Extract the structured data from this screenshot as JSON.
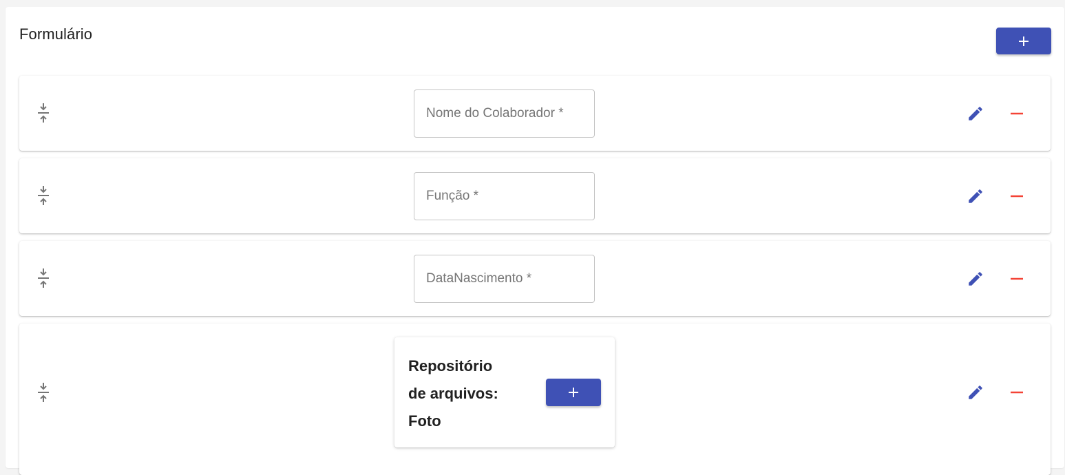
{
  "form": {
    "title": "Formulário",
    "add_icon": "plus-icon"
  },
  "fields": [
    {
      "label": "Nome do Colaborador *"
    },
    {
      "label": "Função *"
    },
    {
      "label": "DataNascimento *"
    }
  ],
  "repository": {
    "line1": "Repositório",
    "line2": "de arquivos:",
    "line3": "Foto"
  },
  "icons": {
    "drag": "drag-compress-icon",
    "edit": "pencil-icon",
    "remove": "minus-icon",
    "add": "plus-icon"
  },
  "colors": {
    "primary": "#3f51b5",
    "danger": "#f44336",
    "drag_icon": "#757575"
  }
}
